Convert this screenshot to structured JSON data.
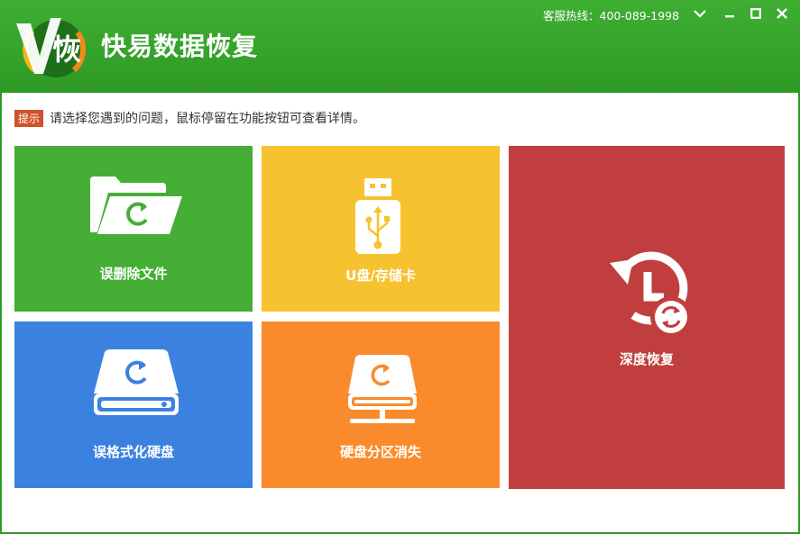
{
  "app": {
    "logo_char": "恢",
    "title": "快易数据恢复"
  },
  "header": {
    "hotline": "客服热线：400-089-1998"
  },
  "window_controls": {
    "icons": [
      "chevron-down-icon",
      "minimize-icon",
      "maximize-icon",
      "close-icon"
    ]
  },
  "hint": {
    "tag": "提示",
    "text": "请选择您遇到的问题，鼠标停留在功能按钮可查看详情。"
  },
  "tiles": [
    {
      "label": "误删除文件",
      "color": "#45ae35",
      "icon": "folder-restore-icon"
    },
    {
      "label": "U盘/存储卡",
      "color": "#f7c22f",
      "icon": "usb-drive-icon"
    },
    {
      "label": "深度恢复",
      "color": "#c03f3e",
      "icon": "history-icon"
    },
    {
      "label": "误格式化硬盘",
      "color": "#3b82e0",
      "icon": "hard-disk-icon"
    },
    {
      "label": "硬盘分区消失",
      "color": "#f98b2c",
      "icon": "network-disk-icon"
    }
  ],
  "colors": {
    "titlebar": "#3fae33",
    "hint_tag": "#d2502a"
  }
}
